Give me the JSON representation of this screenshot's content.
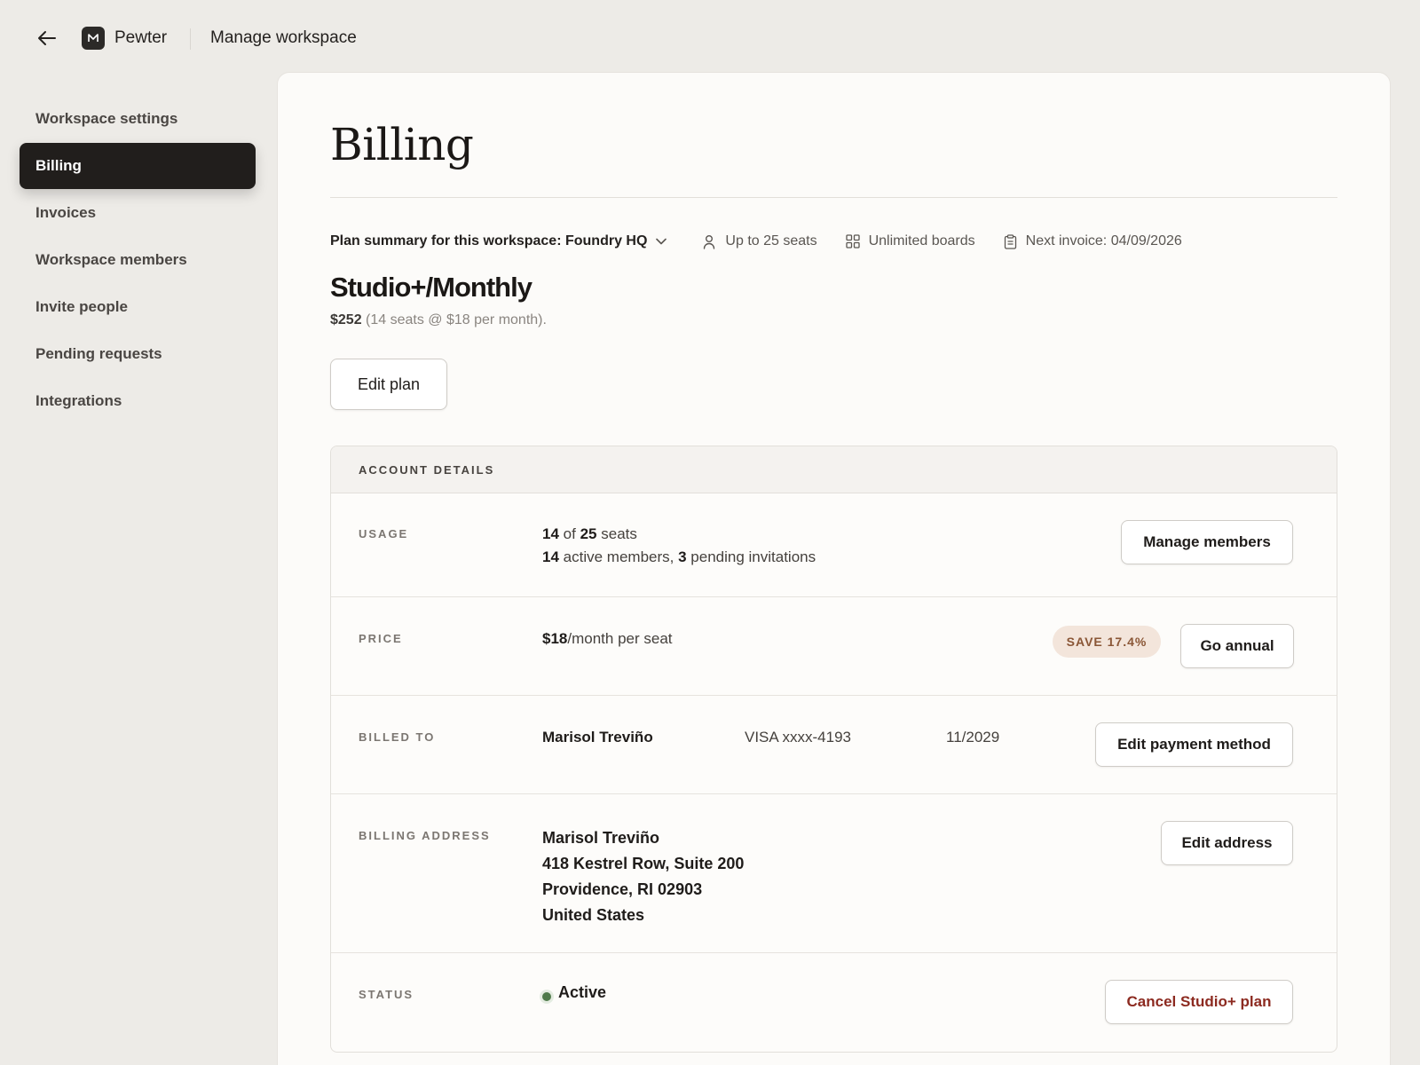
{
  "topbar": {
    "app_name": "Pewter",
    "title": "Manage workspace"
  },
  "sidebar": {
    "items": [
      {
        "label": "Workspace settings"
      },
      {
        "label": "Billing"
      },
      {
        "label": "Invoices"
      },
      {
        "label": "Workspace members"
      },
      {
        "label": "Invite people"
      },
      {
        "label": "Pending requests"
      },
      {
        "label": "Integrations"
      }
    ],
    "active": "Billing"
  },
  "page": {
    "title": "Billing",
    "summary_label": "Plan summary for this workspace: Foundry HQ",
    "seats_meta": "Up to 25 seats",
    "boards_meta": "Unlimited boards",
    "next_invoice": "Next invoice: 04/09/2026",
    "plan_name": "Studio+/Monthly",
    "plan_total": "$252",
    "plan_detail": "(14 seats @ $18 per month).",
    "edit_plan_label": "Edit plan"
  },
  "account": {
    "header": "ACCOUNT DETAILS",
    "usage": {
      "label": "USAGE",
      "seats_used": "14",
      "of": "of",
      "seats_total": "25",
      "seats_word": "seats",
      "active_count": "14",
      "active_text": "active members,",
      "pending_count": "3",
      "pending_text": "pending invitations",
      "button": "Manage members"
    },
    "price": {
      "label": "PRICE",
      "amount": "$18",
      "unit": "/month per seat",
      "badge": "SAVE 17.4%",
      "button": "Go annual"
    },
    "billed_to": {
      "label": "BILLED TO",
      "name": "Marisol Treviño",
      "card": "VISA xxxx-4193",
      "expiry": "11/2029",
      "button": "Edit payment method"
    },
    "billing_address": {
      "label": "BILLING ADDRESS",
      "lines": [
        "Marisol Treviño",
        "418 Kestrel Row, Suite 200",
        "Providence, RI 02903",
        "United States"
      ],
      "button": "Edit address"
    },
    "status": {
      "label": "STATUS",
      "value": "Active",
      "button": "Cancel Studio+ plan"
    }
  },
  "colors": {
    "background": "#edebe7",
    "card": "#fcfbf9",
    "active_nav": "#211e1c",
    "badge_bg": "#f3e5db",
    "badge_text": "#8a5636",
    "danger": "#8c2a20",
    "status_green": "#4f7a4a"
  }
}
